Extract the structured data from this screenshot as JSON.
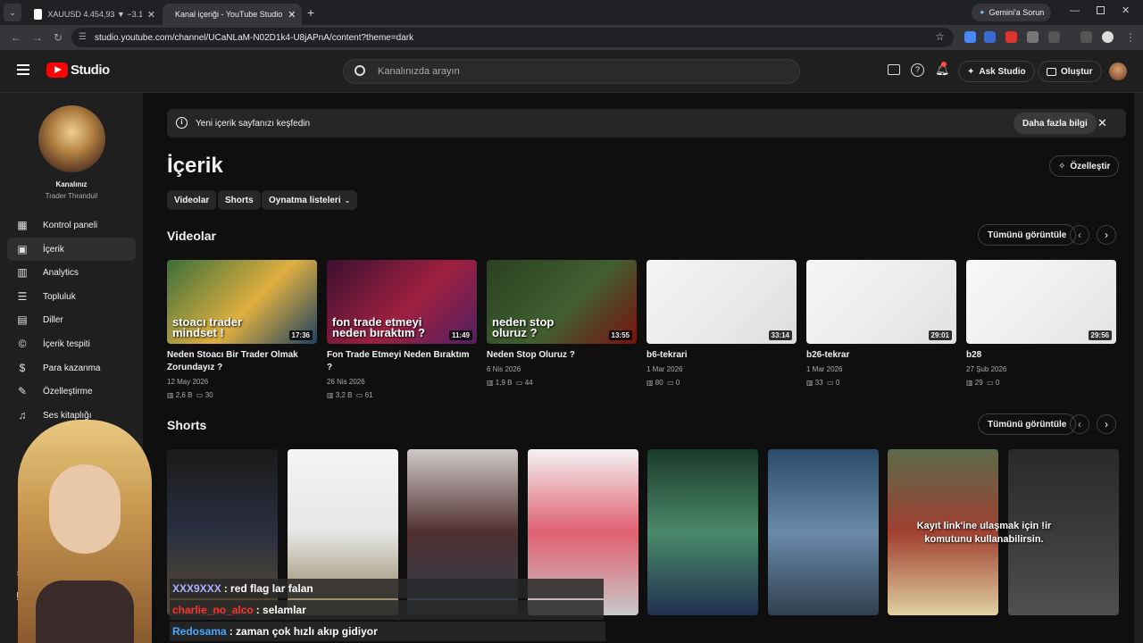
{
  "browser": {
    "tabs": [
      {
        "label": "XAUUSD 4.454,93 ▼ −3.19% A..."
      },
      {
        "label": "Kanal içeriği - YouTube Studio"
      }
    ],
    "url": "studio.youtube.com/channel/UCaNLaM-N02D1k4-U8jAPnA/content?theme=dark",
    "gemini_label": "Gemini'a Sorun"
  },
  "header": {
    "logo_text": "Studio",
    "search_placeholder": "Kanalınızda arayın",
    "ask_studio": "Ask Studio",
    "create": "Oluştur"
  },
  "sidebar": {
    "channel_label": "Kanalınız",
    "channel_name": "Trader Thranduil",
    "items": [
      {
        "label": "Kontrol paneli",
        "icon": "dashboard-icon"
      },
      {
        "label": "İçerik",
        "icon": "content-icon"
      },
      {
        "label": "Analytics",
        "icon": "analytics-icon"
      },
      {
        "label": "Topluluk",
        "icon": "community-icon"
      },
      {
        "label": "Diller",
        "icon": "subtitles-icon"
      },
      {
        "label": "İçerik tespiti",
        "icon": "copyright-icon"
      },
      {
        "label": "Para kazanma",
        "icon": "dollar-icon"
      },
      {
        "label": "Özelleştirme",
        "icon": "customization-icon"
      },
      {
        "label": "Ses kitaplığı",
        "icon": "audio-library-icon"
      }
    ]
  },
  "banner": {
    "text": "Yeni içerik sayfanızı keşfedin",
    "more": "Daha fazla bilgi"
  },
  "content": {
    "title": "İçerik",
    "customize": "Özelleştir",
    "chips": [
      "Videolar",
      "Shorts",
      "Oynatma listeleri"
    ],
    "videos_title": "Videolar",
    "shorts_title": "Shorts",
    "view_all": "Tümünü görüntüle",
    "videos": [
      {
        "title": "Neden Stoacı Bir Trader Olmak Zorundayız ?",
        "date": "12 May 2026",
        "views": "2,6 B",
        "comments": "30",
        "duration": "17:36",
        "thumb_text": "stoacı trader mindset !",
        "colors": [
          "#3a6e3a",
          "#e0b040",
          "#1e4060"
        ]
      },
      {
        "title": "Fon Trade Etmeyi Neden Bıraktım ?",
        "date": "26 Nis 2026",
        "views": "3,2 B",
        "comments": "61",
        "duration": "11:49",
        "thumb_text": "fon trade etmeyi neden bıraktım ?",
        "colors": [
          "#3a1030",
          "#a02040",
          "#502060"
        ]
      },
      {
        "title": "Neden Stop Oluruz ?",
        "date": "6 Nis 2026",
        "views": "1,9 B",
        "comments": "44",
        "duration": "13:55",
        "thumb_text": "neden stop oluruz ?",
        "colors": [
          "#2a4020",
          "#406030",
          "#7a1010"
        ]
      },
      {
        "title": "b6-tekrari",
        "date": "1 Mar 2026",
        "views": "80",
        "comments": "0",
        "duration": "33:14",
        "thumb_text": "",
        "colors": [
          "#f4f4f4",
          "#eaeaea",
          "#ddd"
        ]
      },
      {
        "title": "b26-tekrar",
        "date": "1 Mar 2026",
        "views": "33",
        "comments": "0",
        "duration": "29:01",
        "thumb_text": "",
        "colors": [
          "#f6f6f6",
          "#ececec",
          "#e0e0e0"
        ]
      },
      {
        "title": "b28",
        "date": "27 Şub 2026",
        "views": "29",
        "comments": "0",
        "duration": "29:56",
        "thumb_text": "",
        "colors": [
          "#f8f8f8",
          "#eeeeee",
          "#e2e2e2"
        ]
      }
    ],
    "shorts": [
      {
        "colors": [
          "#1a1a1a",
          "#2a3040",
          "#5a4a30"
        ]
      },
      {
        "colors": [
          "#f4f4f4",
          "#e6e6e6",
          "#8a7a50"
        ]
      },
      {
        "colors": [
          "#d0c8c8",
          "#503030",
          "#304050"
        ]
      },
      {
        "colors": [
          "#f2f2f2",
          "#e06070",
          "#c8c8c8"
        ]
      },
      {
        "colors": [
          "#1a3a2a",
          "#4a8a6a",
          "#203050"
        ]
      },
      {
        "colors": [
          "#2a4a6a",
          "#6a8aaa",
          "#304050"
        ]
      },
      {
        "colors": [
          "#5a6a4a",
          "#a04030",
          "#e0d0a0"
        ]
      },
      {
        "colors": [
          "#2a2a2a",
          "#3a3a3a",
          "#505050"
        ]
      }
    ],
    "overlay_text": "Kayıt link'ine ulaşmak için !ir komutunu kullanabilirsin."
  },
  "chat": [
    {
      "user": "XXX9XXX",
      "user_color": "#b0b0ff",
      "message": ": red flag lar falan"
    },
    {
      "user": "charlie_no_alco",
      "user_color": "#ff3030",
      "message": ": selamlar"
    },
    {
      "user": "Redosama",
      "user_color": "#4aa8ff",
      "message": ": zaman çok hızlı akıp gidiyor"
    }
  ]
}
